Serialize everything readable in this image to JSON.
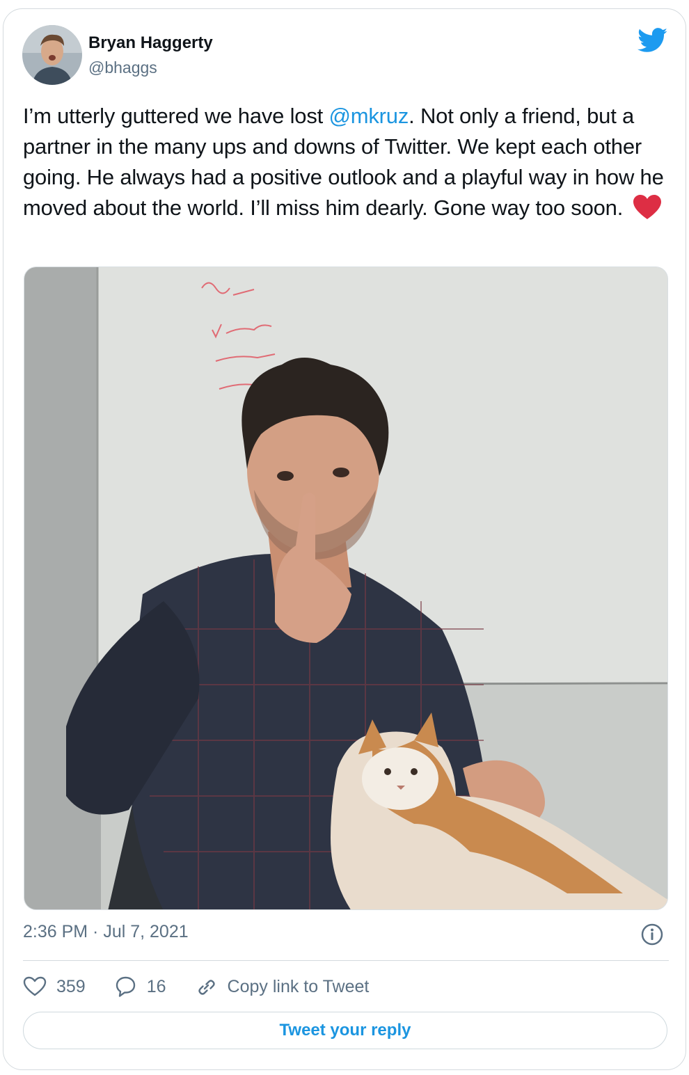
{
  "author": {
    "name": "Bryan Haggerty",
    "handle": "@bhaggs",
    "avatar_icon": "user-avatar"
  },
  "brand_icon": "twitter-bird-icon",
  "tweet": {
    "text_before": "I’m utterly guttered we have lost ",
    "mention": "@mkruz",
    "text_after": ". Not only a friend, but a partner in the many ups and downs of Twitter. We kept each other going. He always had a positive outlook and a playful way in how he moved about the world. I’ll miss him dearly. Gone way too soon.",
    "emoji": "red-heart"
  },
  "media": {
    "alt_icon": "photo"
  },
  "meta": {
    "timestamp": "2:36 PM · Jul 7, 2021"
  },
  "actions": {
    "likes": "359",
    "replies": "16",
    "copy_link_label": "Copy link to Tweet"
  },
  "reply_button_label": "Tweet your reply",
  "colors": {
    "accent": "#1b95e0",
    "secondary_text": "#5b7083",
    "heart": "#e0245e"
  }
}
